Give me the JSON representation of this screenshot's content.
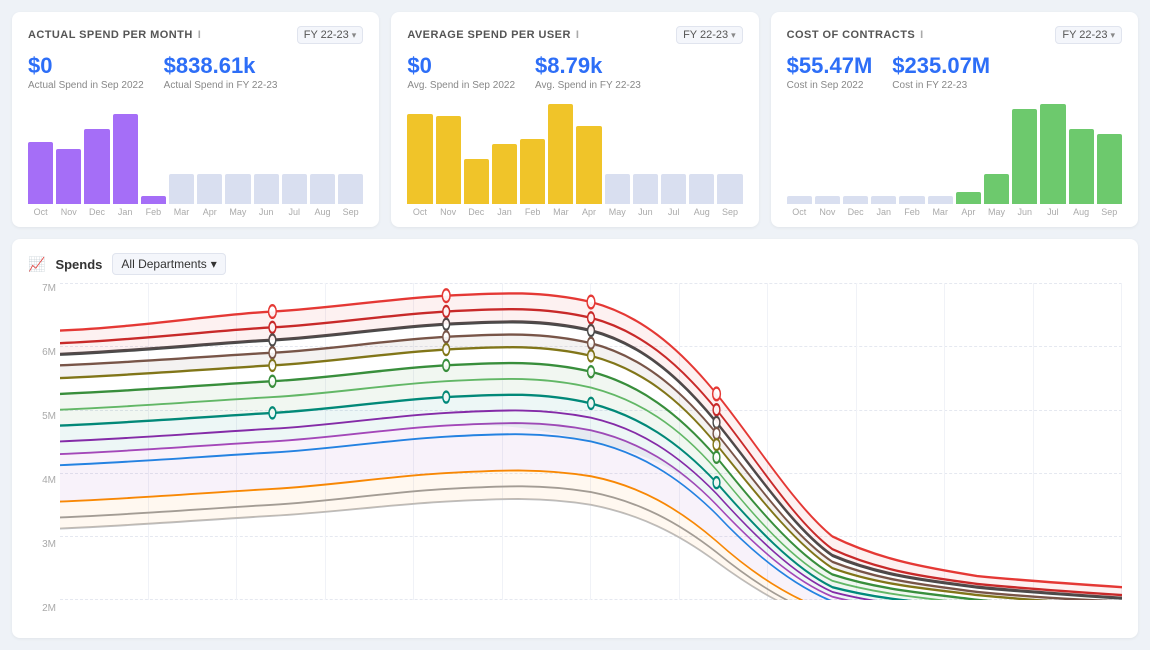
{
  "cards": [
    {
      "id": "actual-spend",
      "title": "ACTUAL SPEND PER MONTH",
      "fy_label": "FY 22-23",
      "metric1_value": "$0",
      "metric1_label": "Actual Spend in Sep 2022",
      "metric2_value": "$838.61k",
      "metric2_label": "Actual Spend in FY 22-23",
      "bar_color": "#a56ef7",
      "bar_color_light": "#d9d0f7",
      "bars": [
        {
          "label": "Oct",
          "height": 62,
          "active": true
        },
        {
          "label": "Nov",
          "height": 55,
          "active": true
        },
        {
          "label": "Dec",
          "height": 75,
          "active": true
        },
        {
          "label": "Jan",
          "height": 90,
          "active": true
        },
        {
          "label": "Feb",
          "height": 8,
          "active": true
        },
        {
          "label": "Mar",
          "height": 30,
          "active": false
        },
        {
          "label": "Apr",
          "height": 30,
          "active": false
        },
        {
          "label": "May",
          "height": 30,
          "active": false
        },
        {
          "label": "Jun",
          "height": 30,
          "active": false
        },
        {
          "label": "Jul",
          "height": 30,
          "active": false
        },
        {
          "label": "Aug",
          "height": 30,
          "active": false
        },
        {
          "label": "Sep",
          "height": 30,
          "active": false
        }
      ]
    },
    {
      "id": "avg-spend",
      "title": "AVERAGE SPEND PER USER",
      "fy_label": "FY 22-23",
      "metric1_value": "$0",
      "metric1_label": "Avg. Spend in Sep 2022",
      "metric2_value": "$8.79k",
      "metric2_label": "Avg. Spend in FY 22-23",
      "bar_color": "#f0c429",
      "bar_color_light": "#d9d0f7",
      "bars": [
        {
          "label": "Oct",
          "height": 90,
          "active": true
        },
        {
          "label": "Nov",
          "height": 88,
          "active": true
        },
        {
          "label": "Dec",
          "height": 45,
          "active": true
        },
        {
          "label": "Jan",
          "height": 60,
          "active": true
        },
        {
          "label": "Feb",
          "height": 65,
          "active": true
        },
        {
          "label": "Mar",
          "height": 100,
          "active": true
        },
        {
          "label": "Apr",
          "height": 78,
          "active": true
        },
        {
          "label": "May",
          "height": 30,
          "active": false
        },
        {
          "label": "Jun",
          "height": 30,
          "active": false
        },
        {
          "label": "Jul",
          "height": 30,
          "active": false
        },
        {
          "label": "Aug",
          "height": 30,
          "active": false
        },
        {
          "label": "Sep",
          "height": 30,
          "active": false
        }
      ]
    },
    {
      "id": "cost-contracts",
      "title": "COST OF CONTRACTS",
      "fy_label": "FY 22-23",
      "metric1_value": "$55.47M",
      "metric1_label": "Cost in Sep 2022",
      "metric2_value": "$235.07M",
      "metric2_label": "Cost in FY 22-23",
      "bar_color": "#6dc96d",
      "bar_color_light": "#d9d0f7",
      "bars": [
        {
          "label": "Oct",
          "height": 8,
          "active": false
        },
        {
          "label": "Nov",
          "height": 8,
          "active": false
        },
        {
          "label": "Dec",
          "height": 8,
          "active": false
        },
        {
          "label": "Jan",
          "height": 8,
          "active": false
        },
        {
          "label": "Feb",
          "height": 8,
          "active": false
        },
        {
          "label": "Mar",
          "height": 8,
          "active": false
        },
        {
          "label": "Apr",
          "height": 12,
          "active": true
        },
        {
          "label": "May",
          "height": 30,
          "active": true
        },
        {
          "label": "Jun",
          "height": 95,
          "active": true
        },
        {
          "label": "Jul",
          "height": 100,
          "active": true
        },
        {
          "label": "Aug",
          "height": 75,
          "active": true
        },
        {
          "label": "Sep",
          "height": 70,
          "active": true
        }
      ]
    }
  ],
  "spends_section": {
    "title": "Spends",
    "dept_label": "All Departments",
    "y_labels": [
      "7M",
      "6M",
      "5M",
      "4M",
      "3M",
      "2M"
    ],
    "line_colors": [
      "#e53935",
      "#c62828",
      "#b71c1c",
      "#5d4037",
      "#6d4c41",
      "#388e3c",
      "#43a047",
      "#00897b",
      "#00796b",
      "#8e24aa",
      "#ab47bc",
      "#1e88e5",
      "#039be5",
      "#fb8c00",
      "#f57c00",
      "#757575",
      "#9e9e9e"
    ]
  },
  "icons": {
    "info": "i",
    "chevron_down": "▾",
    "spends_icon": "📊"
  }
}
